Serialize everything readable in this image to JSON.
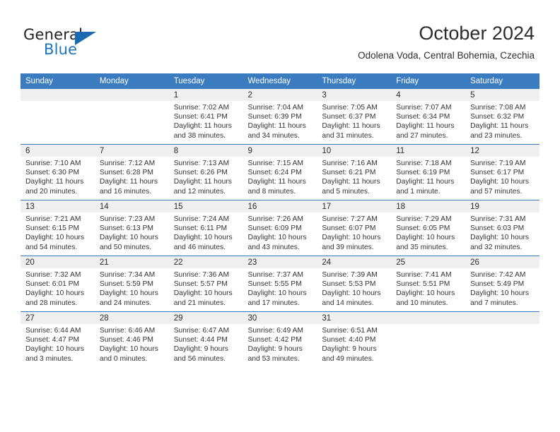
{
  "logo": {
    "word_one": "General",
    "word_two": "Blue",
    "triangle_color": "#1b6ab0",
    "word_two_color": "#1b75bb"
  },
  "header": {
    "title": "October 2024",
    "subtitle": "Odolena Voda, Central Bohemia, Czechia",
    "accent_color": "#3a7cbf"
  },
  "weekday_headers": [
    "Sunday",
    "Monday",
    "Tuesday",
    "Wednesday",
    "Thursday",
    "Friday",
    "Saturday"
  ],
  "weeks": [
    [
      {
        "day": "",
        "sunrise": "",
        "sunset": "",
        "daylight": ""
      },
      {
        "day": "",
        "sunrise": "",
        "sunset": "",
        "daylight": ""
      },
      {
        "day": "1",
        "sunrise": "Sunrise: 7:02 AM",
        "sunset": "Sunset: 6:41 PM",
        "daylight": "Daylight: 11 hours and 38 minutes."
      },
      {
        "day": "2",
        "sunrise": "Sunrise: 7:04 AM",
        "sunset": "Sunset: 6:39 PM",
        "daylight": "Daylight: 11 hours and 34 minutes."
      },
      {
        "day": "3",
        "sunrise": "Sunrise: 7:05 AM",
        "sunset": "Sunset: 6:37 PM",
        "daylight": "Daylight: 11 hours and 31 minutes."
      },
      {
        "day": "4",
        "sunrise": "Sunrise: 7:07 AM",
        "sunset": "Sunset: 6:34 PM",
        "daylight": "Daylight: 11 hours and 27 minutes."
      },
      {
        "day": "5",
        "sunrise": "Sunrise: 7:08 AM",
        "sunset": "Sunset: 6:32 PM",
        "daylight": "Daylight: 11 hours and 23 minutes."
      }
    ],
    [
      {
        "day": "6",
        "sunrise": "Sunrise: 7:10 AM",
        "sunset": "Sunset: 6:30 PM",
        "daylight": "Daylight: 11 hours and 20 minutes."
      },
      {
        "day": "7",
        "sunrise": "Sunrise: 7:12 AM",
        "sunset": "Sunset: 6:28 PM",
        "daylight": "Daylight: 11 hours and 16 minutes."
      },
      {
        "day": "8",
        "sunrise": "Sunrise: 7:13 AM",
        "sunset": "Sunset: 6:26 PM",
        "daylight": "Daylight: 11 hours and 12 minutes."
      },
      {
        "day": "9",
        "sunrise": "Sunrise: 7:15 AM",
        "sunset": "Sunset: 6:24 PM",
        "daylight": "Daylight: 11 hours and 8 minutes."
      },
      {
        "day": "10",
        "sunrise": "Sunrise: 7:16 AM",
        "sunset": "Sunset: 6:21 PM",
        "daylight": "Daylight: 11 hours and 5 minutes."
      },
      {
        "day": "11",
        "sunrise": "Sunrise: 7:18 AM",
        "sunset": "Sunset: 6:19 PM",
        "daylight": "Daylight: 11 hours and 1 minute."
      },
      {
        "day": "12",
        "sunrise": "Sunrise: 7:19 AM",
        "sunset": "Sunset: 6:17 PM",
        "daylight": "Daylight: 10 hours and 57 minutes."
      }
    ],
    [
      {
        "day": "13",
        "sunrise": "Sunrise: 7:21 AM",
        "sunset": "Sunset: 6:15 PM",
        "daylight": "Daylight: 10 hours and 54 minutes."
      },
      {
        "day": "14",
        "sunrise": "Sunrise: 7:23 AM",
        "sunset": "Sunset: 6:13 PM",
        "daylight": "Daylight: 10 hours and 50 minutes."
      },
      {
        "day": "15",
        "sunrise": "Sunrise: 7:24 AM",
        "sunset": "Sunset: 6:11 PM",
        "daylight": "Daylight: 10 hours and 46 minutes."
      },
      {
        "day": "16",
        "sunrise": "Sunrise: 7:26 AM",
        "sunset": "Sunset: 6:09 PM",
        "daylight": "Daylight: 10 hours and 43 minutes."
      },
      {
        "day": "17",
        "sunrise": "Sunrise: 7:27 AM",
        "sunset": "Sunset: 6:07 PM",
        "daylight": "Daylight: 10 hours and 39 minutes."
      },
      {
        "day": "18",
        "sunrise": "Sunrise: 7:29 AM",
        "sunset": "Sunset: 6:05 PM",
        "daylight": "Daylight: 10 hours and 35 minutes."
      },
      {
        "day": "19",
        "sunrise": "Sunrise: 7:31 AM",
        "sunset": "Sunset: 6:03 PM",
        "daylight": "Daylight: 10 hours and 32 minutes."
      }
    ],
    [
      {
        "day": "20",
        "sunrise": "Sunrise: 7:32 AM",
        "sunset": "Sunset: 6:01 PM",
        "daylight": "Daylight: 10 hours and 28 minutes."
      },
      {
        "day": "21",
        "sunrise": "Sunrise: 7:34 AM",
        "sunset": "Sunset: 5:59 PM",
        "daylight": "Daylight: 10 hours and 24 minutes."
      },
      {
        "day": "22",
        "sunrise": "Sunrise: 7:36 AM",
        "sunset": "Sunset: 5:57 PM",
        "daylight": "Daylight: 10 hours and 21 minutes."
      },
      {
        "day": "23",
        "sunrise": "Sunrise: 7:37 AM",
        "sunset": "Sunset: 5:55 PM",
        "daylight": "Daylight: 10 hours and 17 minutes."
      },
      {
        "day": "24",
        "sunrise": "Sunrise: 7:39 AM",
        "sunset": "Sunset: 5:53 PM",
        "daylight": "Daylight: 10 hours and 14 minutes."
      },
      {
        "day": "25",
        "sunrise": "Sunrise: 7:41 AM",
        "sunset": "Sunset: 5:51 PM",
        "daylight": "Daylight: 10 hours and 10 minutes."
      },
      {
        "day": "26",
        "sunrise": "Sunrise: 7:42 AM",
        "sunset": "Sunset: 5:49 PM",
        "daylight": "Daylight: 10 hours and 7 minutes."
      }
    ],
    [
      {
        "day": "27",
        "sunrise": "Sunrise: 6:44 AM",
        "sunset": "Sunset: 4:47 PM",
        "daylight": "Daylight: 10 hours and 3 minutes."
      },
      {
        "day": "28",
        "sunrise": "Sunrise: 6:46 AM",
        "sunset": "Sunset: 4:46 PM",
        "daylight": "Daylight: 10 hours and 0 minutes."
      },
      {
        "day": "29",
        "sunrise": "Sunrise: 6:47 AM",
        "sunset": "Sunset: 4:44 PM",
        "daylight": "Daylight: 9 hours and 56 minutes."
      },
      {
        "day": "30",
        "sunrise": "Sunrise: 6:49 AM",
        "sunset": "Sunset: 4:42 PM",
        "daylight": "Daylight: 9 hours and 53 minutes."
      },
      {
        "day": "31",
        "sunrise": "Sunrise: 6:51 AM",
        "sunset": "Sunset: 4:40 PM",
        "daylight": "Daylight: 9 hours and 49 minutes."
      },
      {
        "day": "",
        "sunrise": "",
        "sunset": "",
        "daylight": ""
      },
      {
        "day": "",
        "sunrise": "",
        "sunset": "",
        "daylight": ""
      }
    ]
  ]
}
